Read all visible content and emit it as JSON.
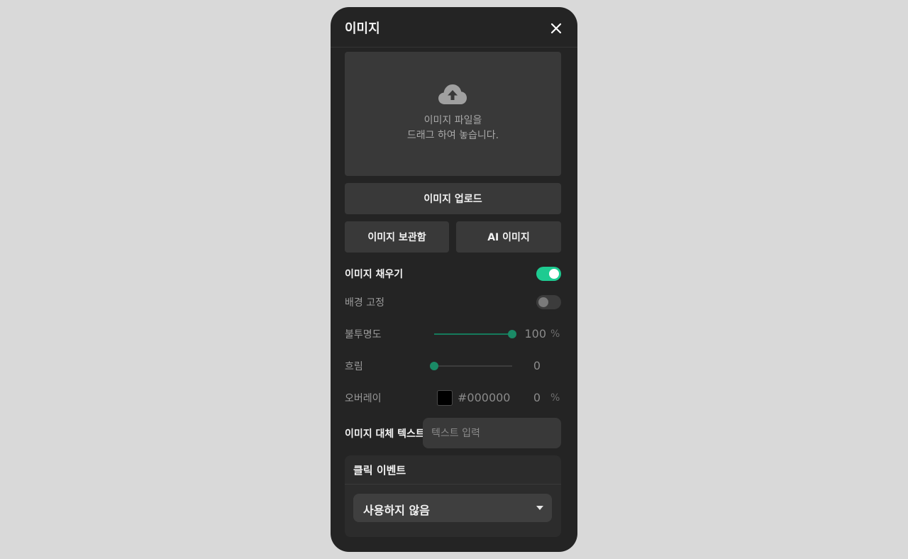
{
  "panel": {
    "title": "이미지",
    "close_icon": "close-icon"
  },
  "dropzone": {
    "icon": "cloud-upload-icon",
    "line1": "이미지 파일을",
    "line2": "드래그 하여 놓습니다."
  },
  "buttons": {
    "upload": "이미지 업로드",
    "library": "이미지 보관함",
    "ai": "AI 이미지"
  },
  "fill": {
    "label": "이미지 채우기",
    "on": true
  },
  "fixed_bg": {
    "label": "배경 고정",
    "on": false
  },
  "opacity": {
    "label": "불투명도",
    "value": "100",
    "unit": "%",
    "fraction": 1.0
  },
  "blur": {
    "label": "흐림",
    "value": "0",
    "fraction": 0.0
  },
  "overlay": {
    "label": "오버레이",
    "color": "#000000",
    "hex": "#000000",
    "value": "0",
    "unit": "%"
  },
  "alt_text": {
    "label": "이미지 대체 텍스트",
    "placeholder": "텍스트 입력",
    "value": ""
  },
  "click_event": {
    "title": "클릭 이벤트",
    "selected": "사용하지 않음"
  },
  "colors": {
    "accent": "#1ecb91",
    "panel_bg": "#242424",
    "surface": "#393939"
  }
}
